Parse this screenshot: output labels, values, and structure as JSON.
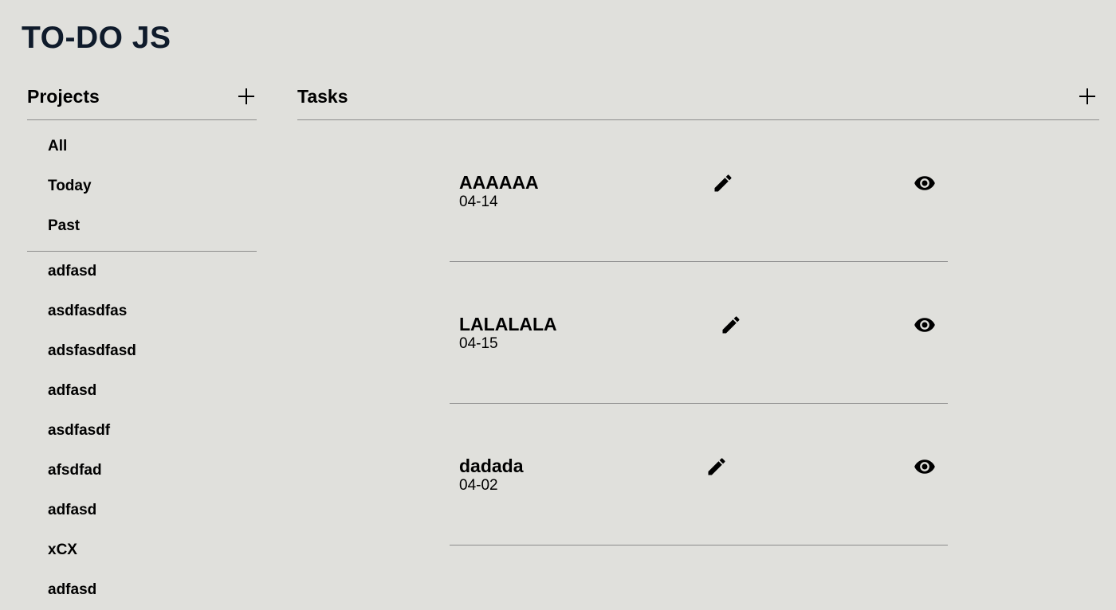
{
  "app": {
    "title": "TO-DO JS"
  },
  "projects_panel": {
    "title": "Projects",
    "filters": [
      {
        "label": "All"
      },
      {
        "label": "Today"
      },
      {
        "label": "Past"
      }
    ],
    "projects": [
      {
        "label": "adfasd"
      },
      {
        "label": "asdfasdfas"
      },
      {
        "label": "adsfasdfasd"
      },
      {
        "label": "adfasd"
      },
      {
        "label": "asdfasdf"
      },
      {
        "label": "afsdfad"
      },
      {
        "label": "adfasd"
      },
      {
        "label": "xCX"
      },
      {
        "label": "adfasd"
      }
    ]
  },
  "tasks_panel": {
    "title": "Tasks",
    "tasks": [
      {
        "title": "AAAAAA",
        "date": "04-14"
      },
      {
        "title": "LALALALA",
        "date": "04-15"
      },
      {
        "title": "dadada",
        "date": "04-02"
      }
    ]
  },
  "icons": {
    "add": "plus-icon",
    "edit": "pencil-icon",
    "view": "eye-icon"
  }
}
